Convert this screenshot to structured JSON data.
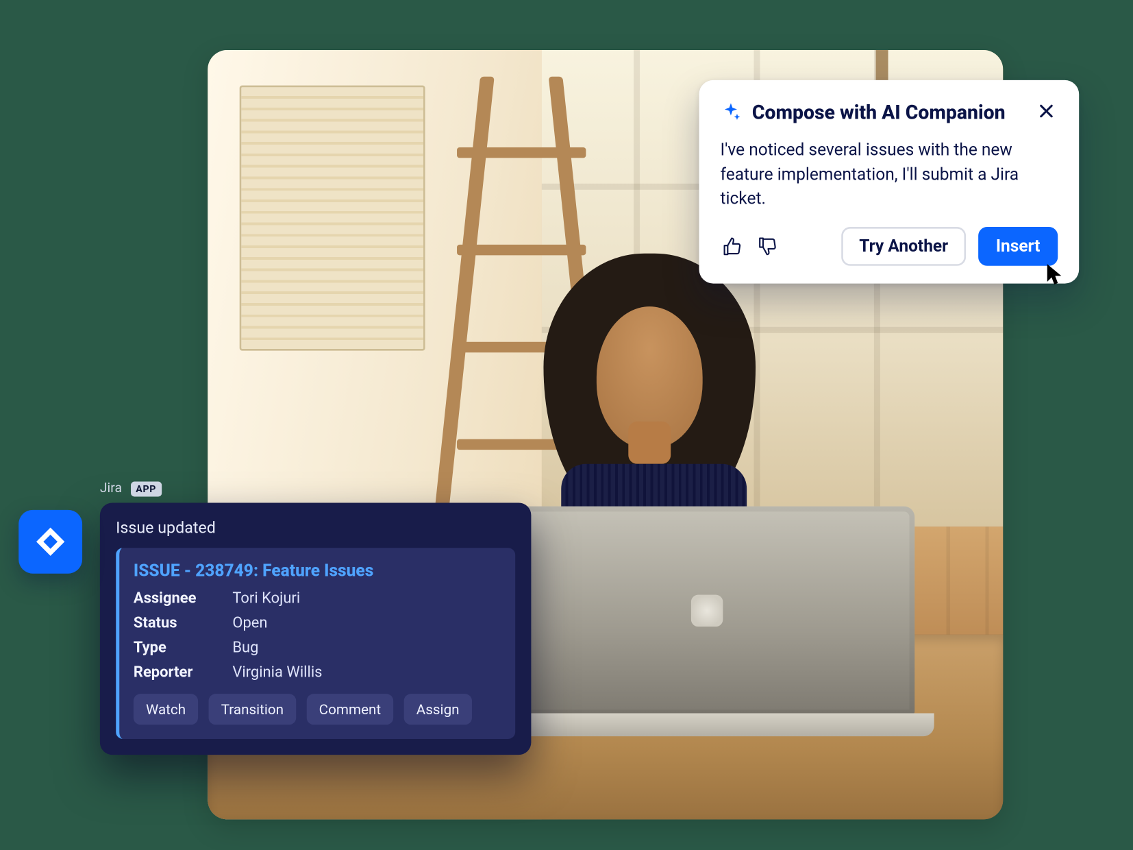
{
  "ai_popup": {
    "title": "Compose with AI Companion",
    "body": "I've noticed several issues with the new feature implementation, I'll submit a Jira ticket.",
    "try_another_label": "Try Another",
    "insert_label": "Insert"
  },
  "jira": {
    "brand": "Jira",
    "badge": "APP",
    "subtitle": "Issue updated",
    "issue_title": "ISSUE - 238749: Feature Issues",
    "fields": {
      "assignee_label": "Assignee",
      "assignee_value": "Tori Kojuri",
      "status_label": "Status",
      "status_value": "Open",
      "type_label": "Type",
      "type_value": "Bug",
      "reporter_label": "Reporter",
      "reporter_value": "Virginia Willis"
    },
    "actions": {
      "watch": "Watch",
      "transition": "Transition",
      "comment": "Comment",
      "assign": "Assign"
    }
  },
  "colors": {
    "primary_blue": "#0b66ff",
    "deep_navy": "#181c4a",
    "panel_navy": "#2a2f66",
    "accent_blue": "#4fa3ff",
    "text_navy": "#0b1447"
  }
}
